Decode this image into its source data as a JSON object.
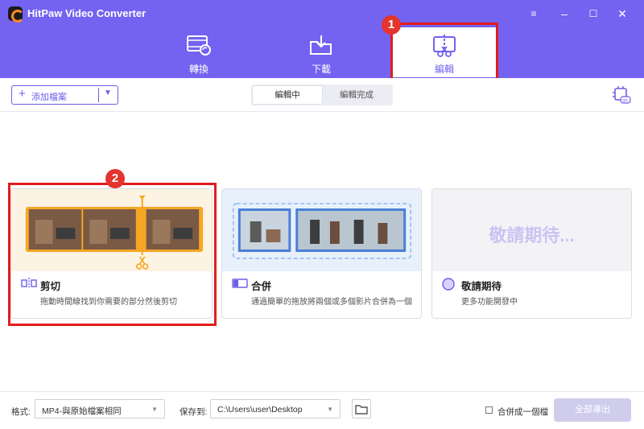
{
  "app": {
    "title": "HitPaw Video Converter"
  },
  "window_controls": {
    "minimize": "–",
    "maximize": "☐",
    "close": "✕",
    "settings": "≡"
  },
  "nav": {
    "tabs": [
      {
        "label": "轉換",
        "icon": "convert-film-icon"
      },
      {
        "label": "下載",
        "icon": "download-folder-icon"
      },
      {
        "label": "編輯",
        "icon": "edit-cut-icon",
        "active": true
      }
    ]
  },
  "callouts": {
    "first": "1",
    "second": "2"
  },
  "toolbar": {
    "add_files": "添加檔案",
    "add_plus": "+",
    "add_caret": "▼",
    "segment": {
      "editing": "編輯中",
      "done": "編輯完成"
    },
    "hw_accel_icon": "hardware-acceleration-icon"
  },
  "cards": {
    "cut": {
      "title": "剪切",
      "desc": "拖動時間線找到你需要的部分然後剪切",
      "icon": "cut-split-icon"
    },
    "merge": {
      "title": "合併",
      "desc": "通過簡單的拖放將兩個或多個影片合併為一個",
      "icon": "merge-icon"
    },
    "soon": {
      "title": "敬請期待",
      "desc": "更多功能開發中",
      "banner": "敬請期待...",
      "icon": "coming-soon-icon"
    }
  },
  "footer": {
    "format_label": "格式:",
    "format_value": "MP4-與原始檔案相同",
    "save_label": "保存到:",
    "save_path": "C:\\Users\\user\\Desktop",
    "merge_label": "合併成一個檔",
    "export_all": "全部導出",
    "dropdown_caret": "▼"
  },
  "colors": {
    "accent": "#7462f0",
    "callout": "#e31c1c",
    "cut_accent": "#f5a623"
  }
}
